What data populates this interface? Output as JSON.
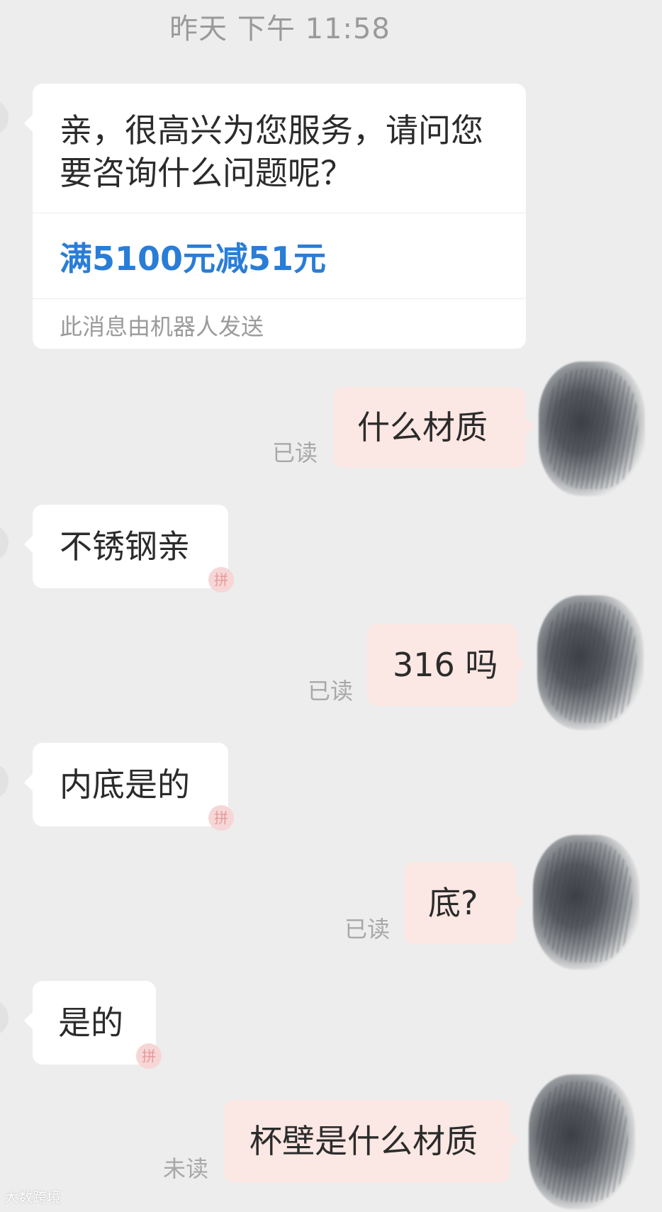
{
  "chat": {
    "timestamp": "昨天 下午 11:58",
    "welcome_card": {
      "greeting": "亲，很高兴为您服务，请问您要咨询什么问题呢？",
      "promo": "满5100元减51元",
      "robot_note": "此消息由机器人发送"
    },
    "messages": [
      {
        "side": "right",
        "text": "什么材质",
        "status": "已读"
      },
      {
        "side": "left",
        "text": "不锈钢亲"
      },
      {
        "side": "right",
        "text": "316 吗",
        "status": "已读"
      },
      {
        "side": "left",
        "text": "内底是的"
      },
      {
        "side": "right",
        "text": "底?",
        "status": "已读"
      },
      {
        "side": "left",
        "text": "是的"
      },
      {
        "side": "right",
        "text": "杯壁是什么材质",
        "status": "未读"
      }
    ]
  },
  "watermark": "大数跨境",
  "colors": {
    "background": "#ededed",
    "bubble_left": "#ffffff",
    "bubble_right": "#fbe7e3",
    "promo_text": "#2a7dd6"
  }
}
